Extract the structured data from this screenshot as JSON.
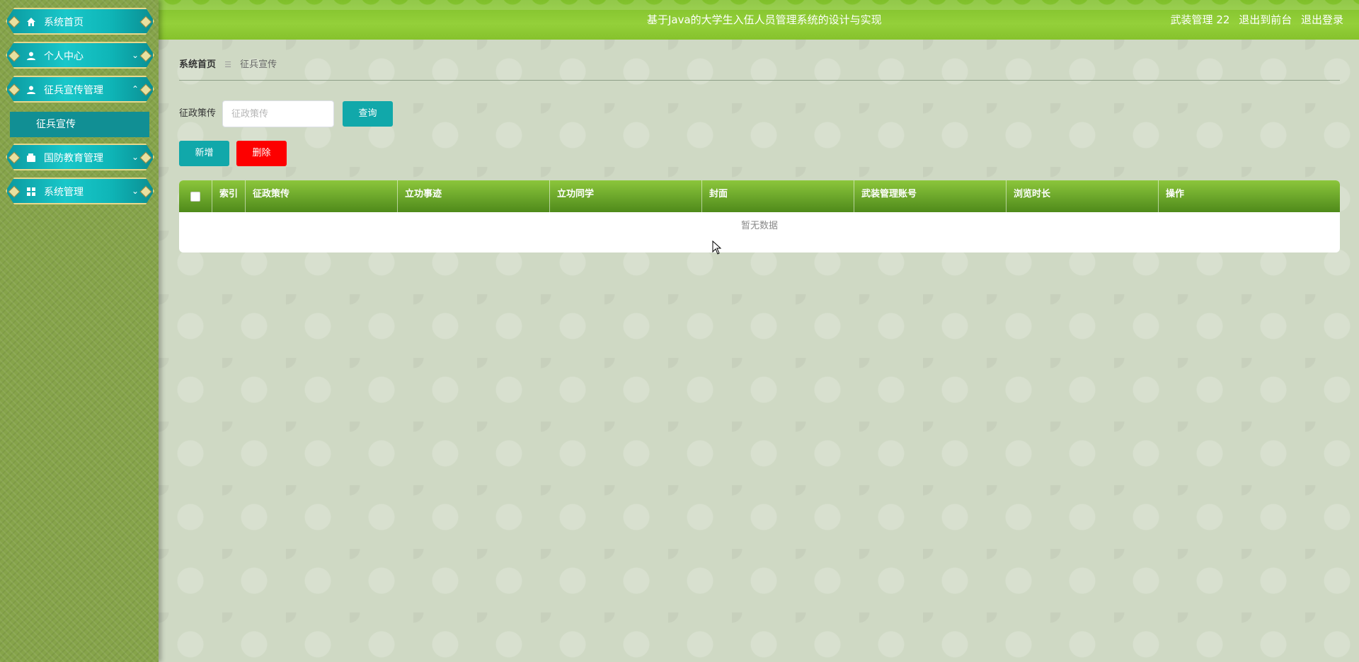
{
  "sidebar": {
    "items": [
      {
        "label": "系统首页",
        "icon": "home-icon",
        "chevron": ""
      },
      {
        "label": "个人中心",
        "icon": "user-icon",
        "chevron": "⌄"
      },
      {
        "label": "征兵宣传管理",
        "icon": "user-icon",
        "chevron": "⌃"
      },
      {
        "label": "国防教育管理",
        "icon": "wallet-icon",
        "chevron": "⌄"
      },
      {
        "label": "系统管理",
        "icon": "grid-icon",
        "chevron": "⌄"
      }
    ],
    "submenu": {
      "label": "征兵宣传"
    }
  },
  "header": {
    "title": "基于Java的大学生入伍人员管理系统的设计与实现",
    "user": "武装管理 22",
    "front": "退出到前台",
    "logout": "退出登录"
  },
  "breadcrumb": {
    "home": "系统首页",
    "sep": "☰",
    "current": "征兵宣传"
  },
  "search": {
    "label": "征政策传",
    "placeholder": "征政策传",
    "value": "",
    "query_label": "查询"
  },
  "actions": {
    "add_label": "新增",
    "delete_label": "删除"
  },
  "table": {
    "columns": [
      "索引",
      "征政策传",
      "立功事迹",
      "立功同学",
      "封面",
      "武装管理账号",
      "浏览时长",
      "操作"
    ],
    "empty_text": "暂无数据"
  },
  "colors": {
    "accent": "#11a8aa",
    "danger": "#fd0000",
    "header": "#8cc63b",
    "sidebar": "#86a44a"
  }
}
